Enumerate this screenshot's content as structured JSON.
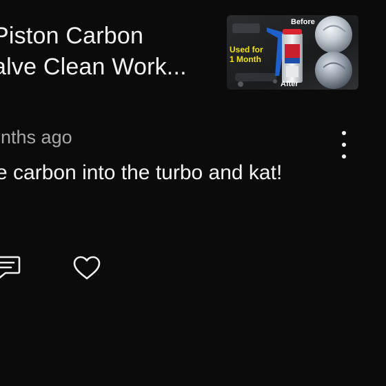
{
  "video": {
    "title_line1": "Piston Carbon",
    "title_line2": "alve Clean Work...",
    "thumbnail": {
      "label_before": "Before",
      "label_used_for": "Used for",
      "label_month": "1 Month",
      "label_after": "After"
    }
  },
  "comment": {
    "meta": "onths ago",
    "text": "e carbon into the turbo and kat!"
  },
  "actions": {
    "more_icon": "more-vertical-icon",
    "reply_icon": "reply-comment-icon",
    "like_icon": "heart-icon"
  },
  "colors": {
    "background": "#0b0b0b",
    "text_primary": "#f2f2f2",
    "text_secondary": "#a9a9a9",
    "thumb_label_yellow": "#f3e21a"
  }
}
